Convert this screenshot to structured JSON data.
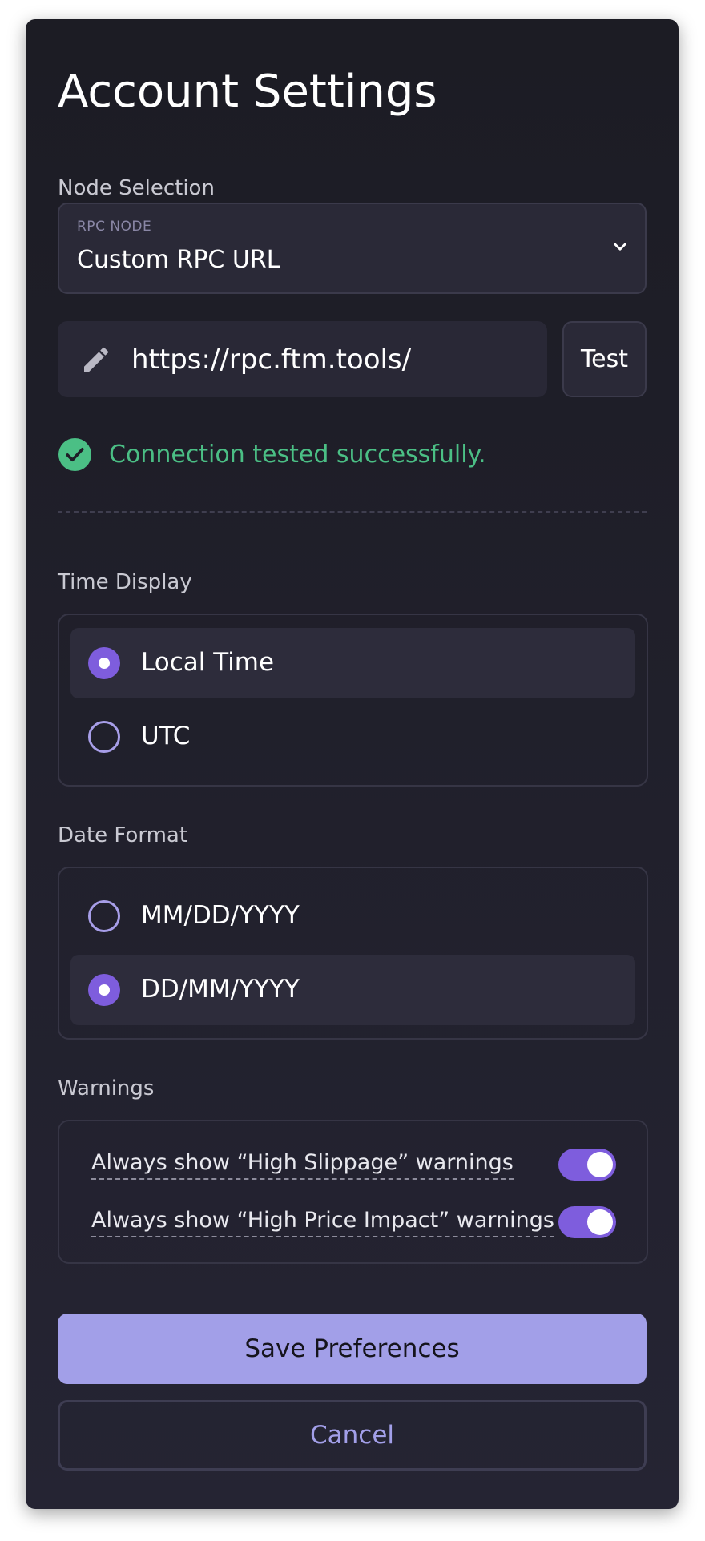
{
  "title": "Account Settings",
  "node": {
    "section_label": "Node Selection",
    "caption": "RPC NODE",
    "selected": "Custom RPC URL",
    "url_value": "https://rpc.ftm.tools/",
    "test_label": "Test",
    "status_text": "Connection tested successfully."
  },
  "time_display": {
    "section_label": "Time Display",
    "options": [
      {
        "label": "Local Time",
        "selected": true
      },
      {
        "label": "UTC",
        "selected": false
      }
    ]
  },
  "date_format": {
    "section_label": "Date Format",
    "options": [
      {
        "label": "MM/DD/YYYY",
        "selected": false
      },
      {
        "label": "DD/MM/YYYY",
        "selected": true
      }
    ]
  },
  "warnings": {
    "section_label": "Warnings",
    "items": [
      {
        "label": "Always show “High Slippage” warnings",
        "enabled": true
      },
      {
        "label": "Always show “High Price Impact” warnings",
        "enabled": true
      }
    ]
  },
  "actions": {
    "save_label": "Save Preferences",
    "cancel_label": "Cancel"
  },
  "colors": {
    "accent": "#7e5ddd",
    "primary_button": "#a29fe8",
    "success": "#4bbf85",
    "panel_bg": "#1c1c24"
  },
  "icons": [
    "chevron-down-icon",
    "pencil-icon",
    "check-circle-icon"
  ]
}
